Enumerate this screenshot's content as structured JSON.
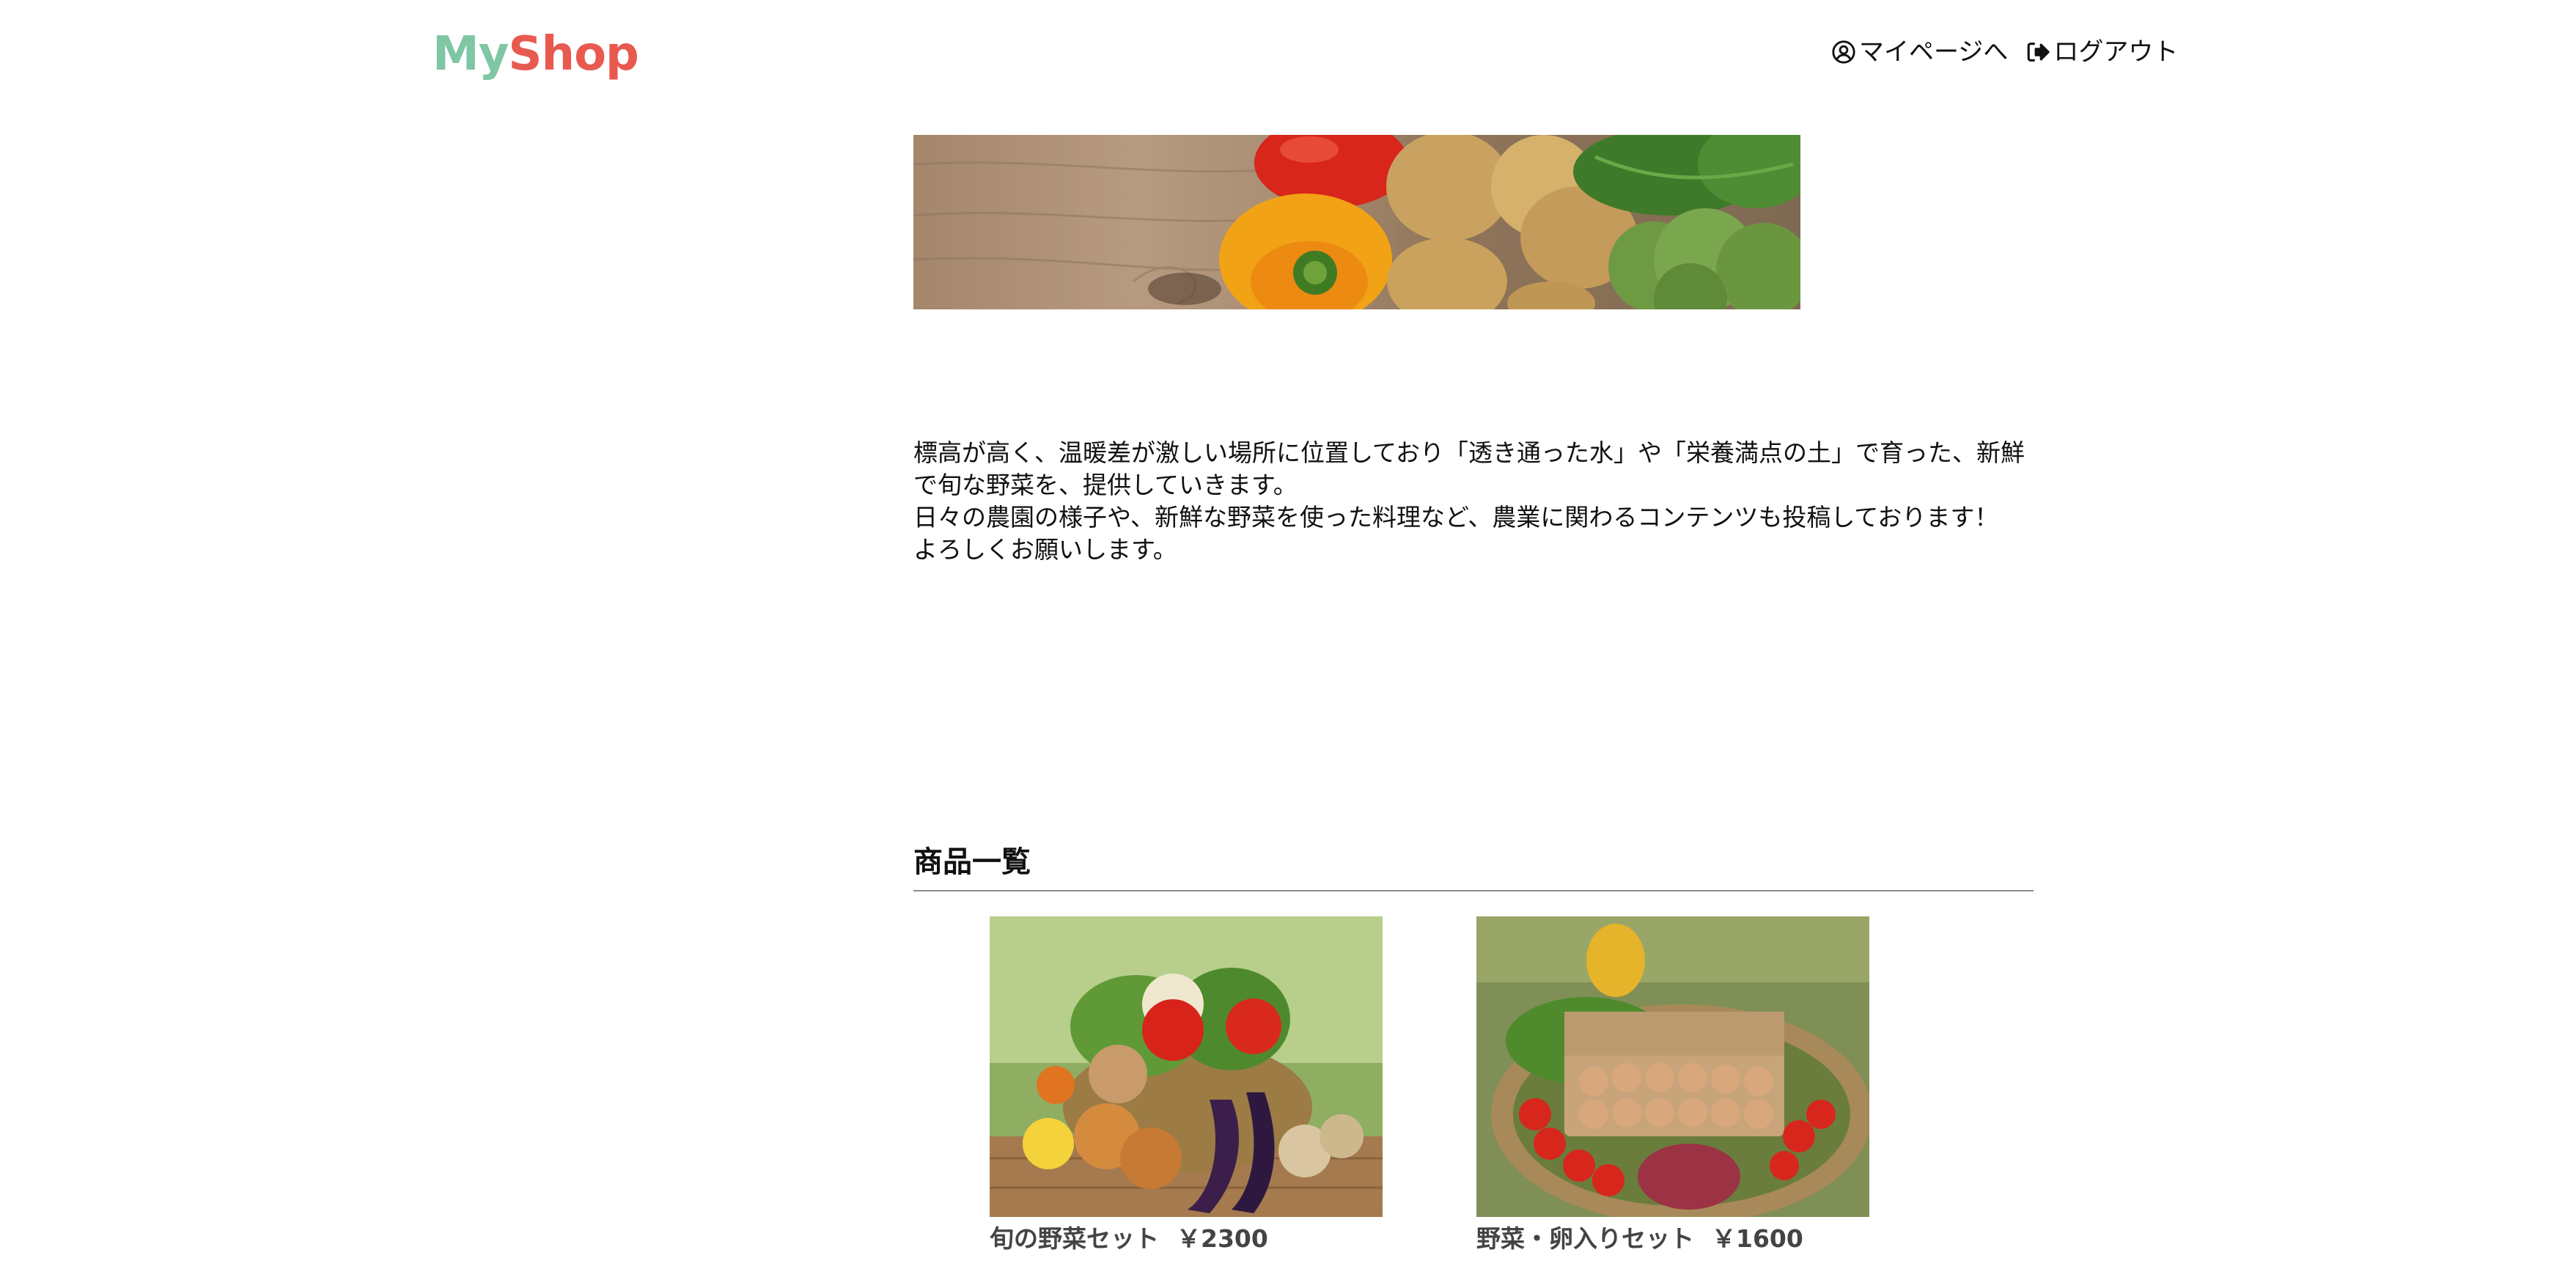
{
  "header": {
    "logo_my": "My",
    "logo_shop": "Shop",
    "mypage_label": "マイページへ",
    "logout_label": "ログアウト",
    "mypage_icon": "user-circle-icon",
    "logout_icon": "sign-out-icon"
  },
  "hero": {
    "alt": "vegetables banner"
  },
  "description": {
    "lines": [
      "標高が高く、温暖差が激しい場所に位置しており「透き通った水」や「栄養満点の土」で育った、新鮮で旬な野菜を、提供していきます。",
      "日々の農園の様子や、新鮮な野菜を使った料理など、農業に関わるコンテンツも投稿しております！",
      "よろしくお願いします。"
    ]
  },
  "products_section": {
    "title": "商品一覧",
    "items": [
      {
        "name": "旬の野菜セット",
        "price": "￥2300"
      },
      {
        "name": "野菜・卵入りセット",
        "price": "￥1600"
      }
    ]
  },
  "colors": {
    "logo_gradient_start": "#7fc6a4",
    "logo_gradient_end": "#e8426b",
    "rule": "#8a8a8a"
  }
}
